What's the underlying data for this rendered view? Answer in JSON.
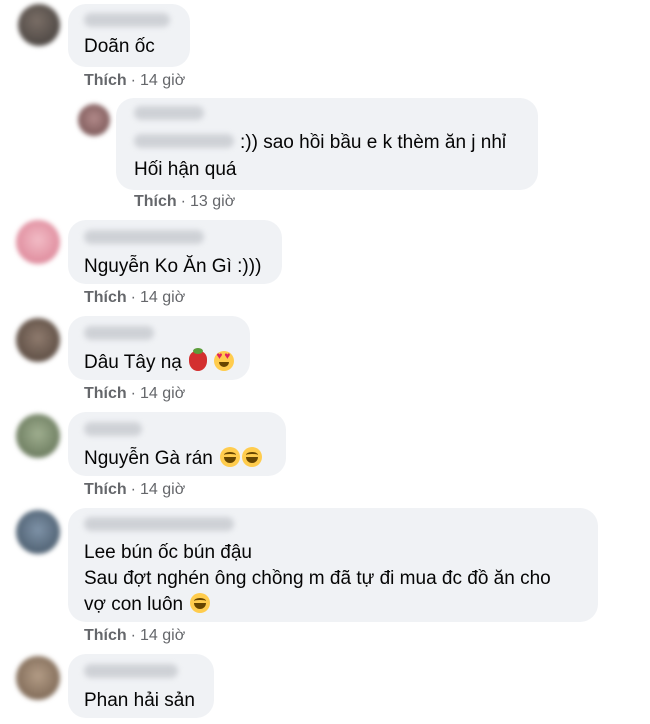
{
  "comments": [
    {
      "text_lines": [
        "Doãn ốc"
      ],
      "like": "Thích",
      "time": "14 giờ"
    },
    {
      "text_lines": [
        ":)) sao hồi bầu e k thèm ăn j nhỉ",
        "Hối hận quá"
      ],
      "like": "Thích",
      "time": "13 giờ"
    },
    {
      "text_lines": [
        "Nguyễn Ko Ăn Gì :)))"
      ],
      "like": "Thích",
      "time": "14 giờ"
    },
    {
      "text_lines": [
        "Dâu Tây nạ"
      ],
      "emojis": [
        "strawberry",
        "smiling-face-with-heart-eyes"
      ],
      "like": "Thích",
      "time": "14 giờ"
    },
    {
      "text_lines": [
        "Nguyễn Gà rán"
      ],
      "emojis": [
        "rolling-on-floor-laughing",
        "rolling-on-floor-laughing"
      ],
      "like": "Thích",
      "time": "14 giờ"
    },
    {
      "text_lines": [
        "Lee bún ốc bún đậu",
        "Sau đợt nghén ông chồng m đã tự đi mua đc đồ ăn cho",
        "vợ con luôn"
      ],
      "emojis": [
        "face-with-tears-of-joy"
      ],
      "like": "Thích",
      "time": "14 giờ"
    },
    {
      "text_lines": [
        "Phan hải sản"
      ]
    }
  ],
  "colors": {
    "bubble": "#f0f2f5",
    "meta": "#65676b",
    "text": "#050505"
  }
}
